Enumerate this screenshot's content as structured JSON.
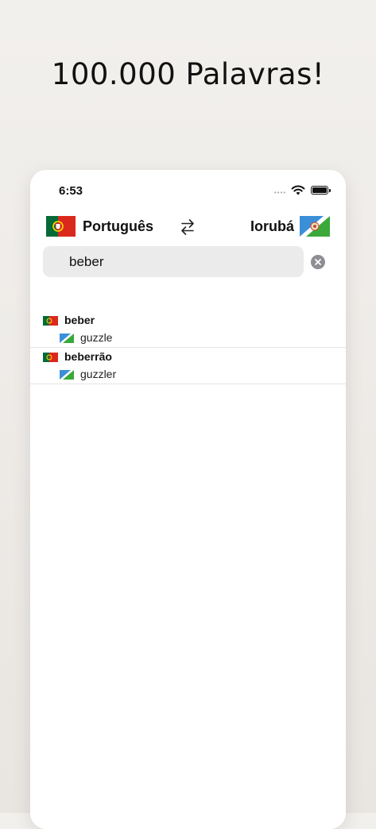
{
  "headline": "100.000 Palavras!",
  "status_bar": {
    "time": "6:53"
  },
  "languages": {
    "source": "Português",
    "target": "Iorubá",
    "source_flag_icon": "portugal-flag-icon",
    "target_flag_icon": "yoruba-flag-icon",
    "swap_icon": "swap-arrows-icon"
  },
  "search": {
    "value": "beber",
    "clear_icon": "clear-circle-icon"
  },
  "results": [
    {
      "word": "beber",
      "translation": "guzzle"
    },
    {
      "word": "beberrão",
      "translation": "guzzler"
    }
  ]
}
